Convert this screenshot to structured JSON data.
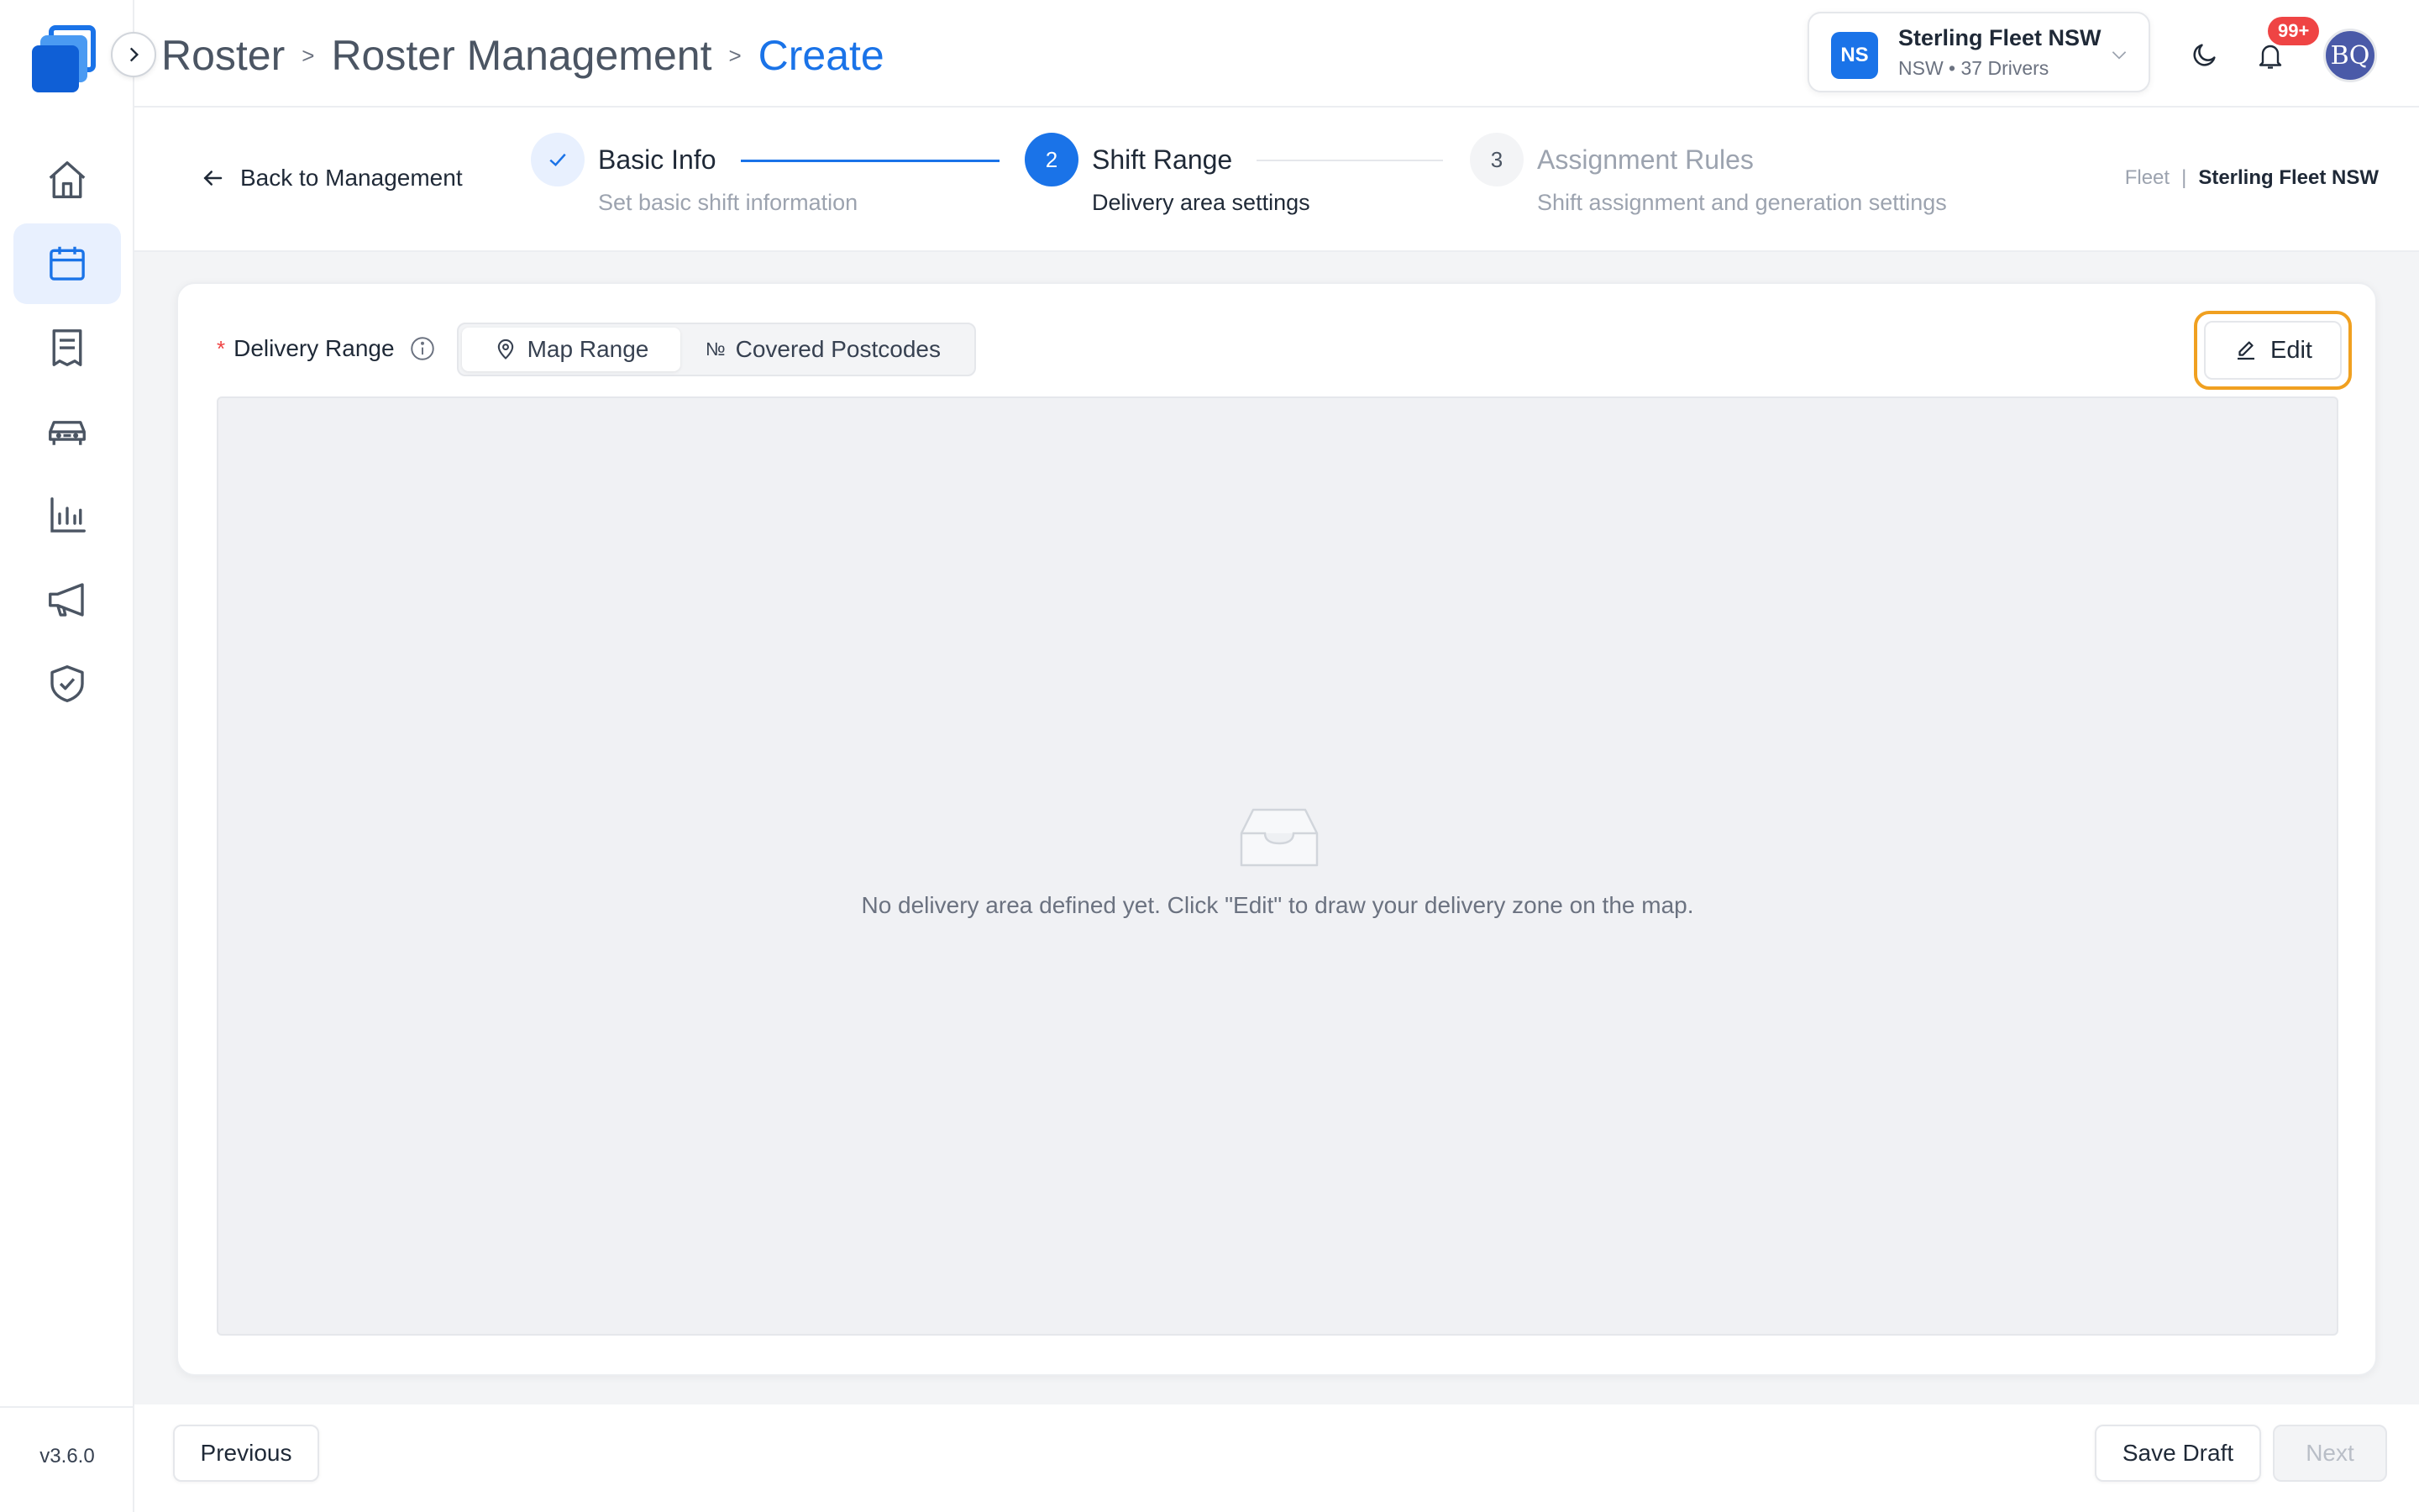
{
  "app": {
    "version": "v3.6.0"
  },
  "breadcrumb": {
    "items": [
      "Roster",
      "Roster Management",
      "Create"
    ]
  },
  "fleet_selector": {
    "avatar": "NS",
    "name": "Sterling Fleet NSW",
    "subtitle": "NSW • 37 Drivers"
  },
  "notifications": {
    "badge": "99+"
  },
  "user": {
    "initials": "BQ"
  },
  "sidebar": {
    "items": [
      {
        "icon": "home-icon",
        "active": false
      },
      {
        "icon": "calendar-icon",
        "active": true
      },
      {
        "icon": "document-icon",
        "active": false
      },
      {
        "icon": "car-icon",
        "active": false
      },
      {
        "icon": "bar-chart-icon",
        "active": false
      },
      {
        "icon": "megaphone-icon",
        "active": false
      },
      {
        "icon": "shield-check-icon",
        "active": false
      }
    ]
  },
  "steps": {
    "back_label": "Back to Management",
    "items": [
      {
        "number": "1",
        "title": "Basic Info",
        "desc": "Set basic shift information",
        "state": "done"
      },
      {
        "number": "2",
        "title": "Shift Range",
        "desc": "Delivery area settings",
        "state": "current"
      },
      {
        "number": "3",
        "title": "Assignment Rules",
        "desc": "Shift assignment and generation settings",
        "state": "pending"
      }
    ],
    "fleet_label": "Fleet",
    "fleet_value": "Sterling Fleet NSW"
  },
  "form": {
    "field_label": "Delivery Range",
    "required_mark": "*",
    "tabs": [
      {
        "label": "Map Range",
        "icon": "map-pin-icon",
        "active": true
      },
      {
        "label": "Covered Postcodes",
        "icon": "numero-icon",
        "icon_text": "№",
        "active": false
      }
    ],
    "edit_label": "Edit",
    "empty_message": "No delivery area defined yet. Click \"Edit\" to draw your delivery zone on the map."
  },
  "footer": {
    "previous": "Previous",
    "save_draft": "Save Draft",
    "next": "Next"
  },
  "colors": {
    "accent": "#1a73e8",
    "highlight": "#f0a020",
    "badge": "#ef4444"
  }
}
